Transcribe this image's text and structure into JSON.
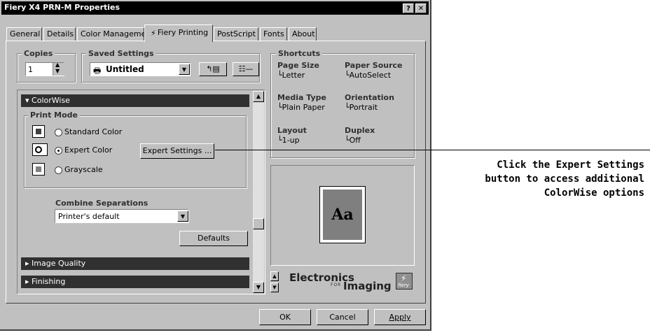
{
  "window": {
    "title": "Fiery X4 PRN-M Properties",
    "help_glyph": "?",
    "close_glyph": "✕"
  },
  "tabs": [
    "General",
    "Details",
    "Color Management",
    "Fiery Printing",
    "PostScript",
    "Fonts",
    "About"
  ],
  "active_tab": "Fiery Printing",
  "copies": {
    "label": "Copies",
    "value": "1"
  },
  "saved_settings": {
    "label": "Saved Settings",
    "value": "Untitled"
  },
  "colorwise": {
    "header": "ColorWise",
    "print_mode_label": "Print Mode",
    "modes": [
      {
        "label": "Standard Color",
        "selected": false
      },
      {
        "label": "Expert Color",
        "selected": true
      },
      {
        "label": "Grayscale",
        "selected": false
      }
    ],
    "expert_settings_button": "Expert Settings ...",
    "combine_label": "Combine Separations",
    "combine_value": "Printer's default",
    "defaults_button": "Defaults"
  },
  "collapsed_sections": [
    "Image Quality",
    "Finishing"
  ],
  "shortcuts": {
    "label": "Shortcuts",
    "items": [
      {
        "head": "Page Size",
        "value": "Letter"
      },
      {
        "head": "Paper Source",
        "value": "AutoSelect"
      },
      {
        "head": "Media Type",
        "value": "Plain Paper"
      },
      {
        "head": "Orientation",
        "value": "Portrait"
      },
      {
        "head": "Layout",
        "value": "1-up"
      },
      {
        "head": "Duplex",
        "value": "Off"
      }
    ]
  },
  "preview": {
    "text": "Aa"
  },
  "brand": {
    "line1": "Electronics",
    "for": "FOR",
    "line2": "Imaging",
    "fiery": "fiery"
  },
  "buttons": {
    "ok": "OK",
    "cancel": "Cancel",
    "apply": "Apply"
  },
  "callout": {
    "lines": [
      "Click the Expert Settings",
      "button to access additional",
      "ColorWise options"
    ]
  },
  "colors": {
    "dark_bar": "#303030",
    "face": "#c0c0c0",
    "preview_fill": "#7f7f7f"
  }
}
